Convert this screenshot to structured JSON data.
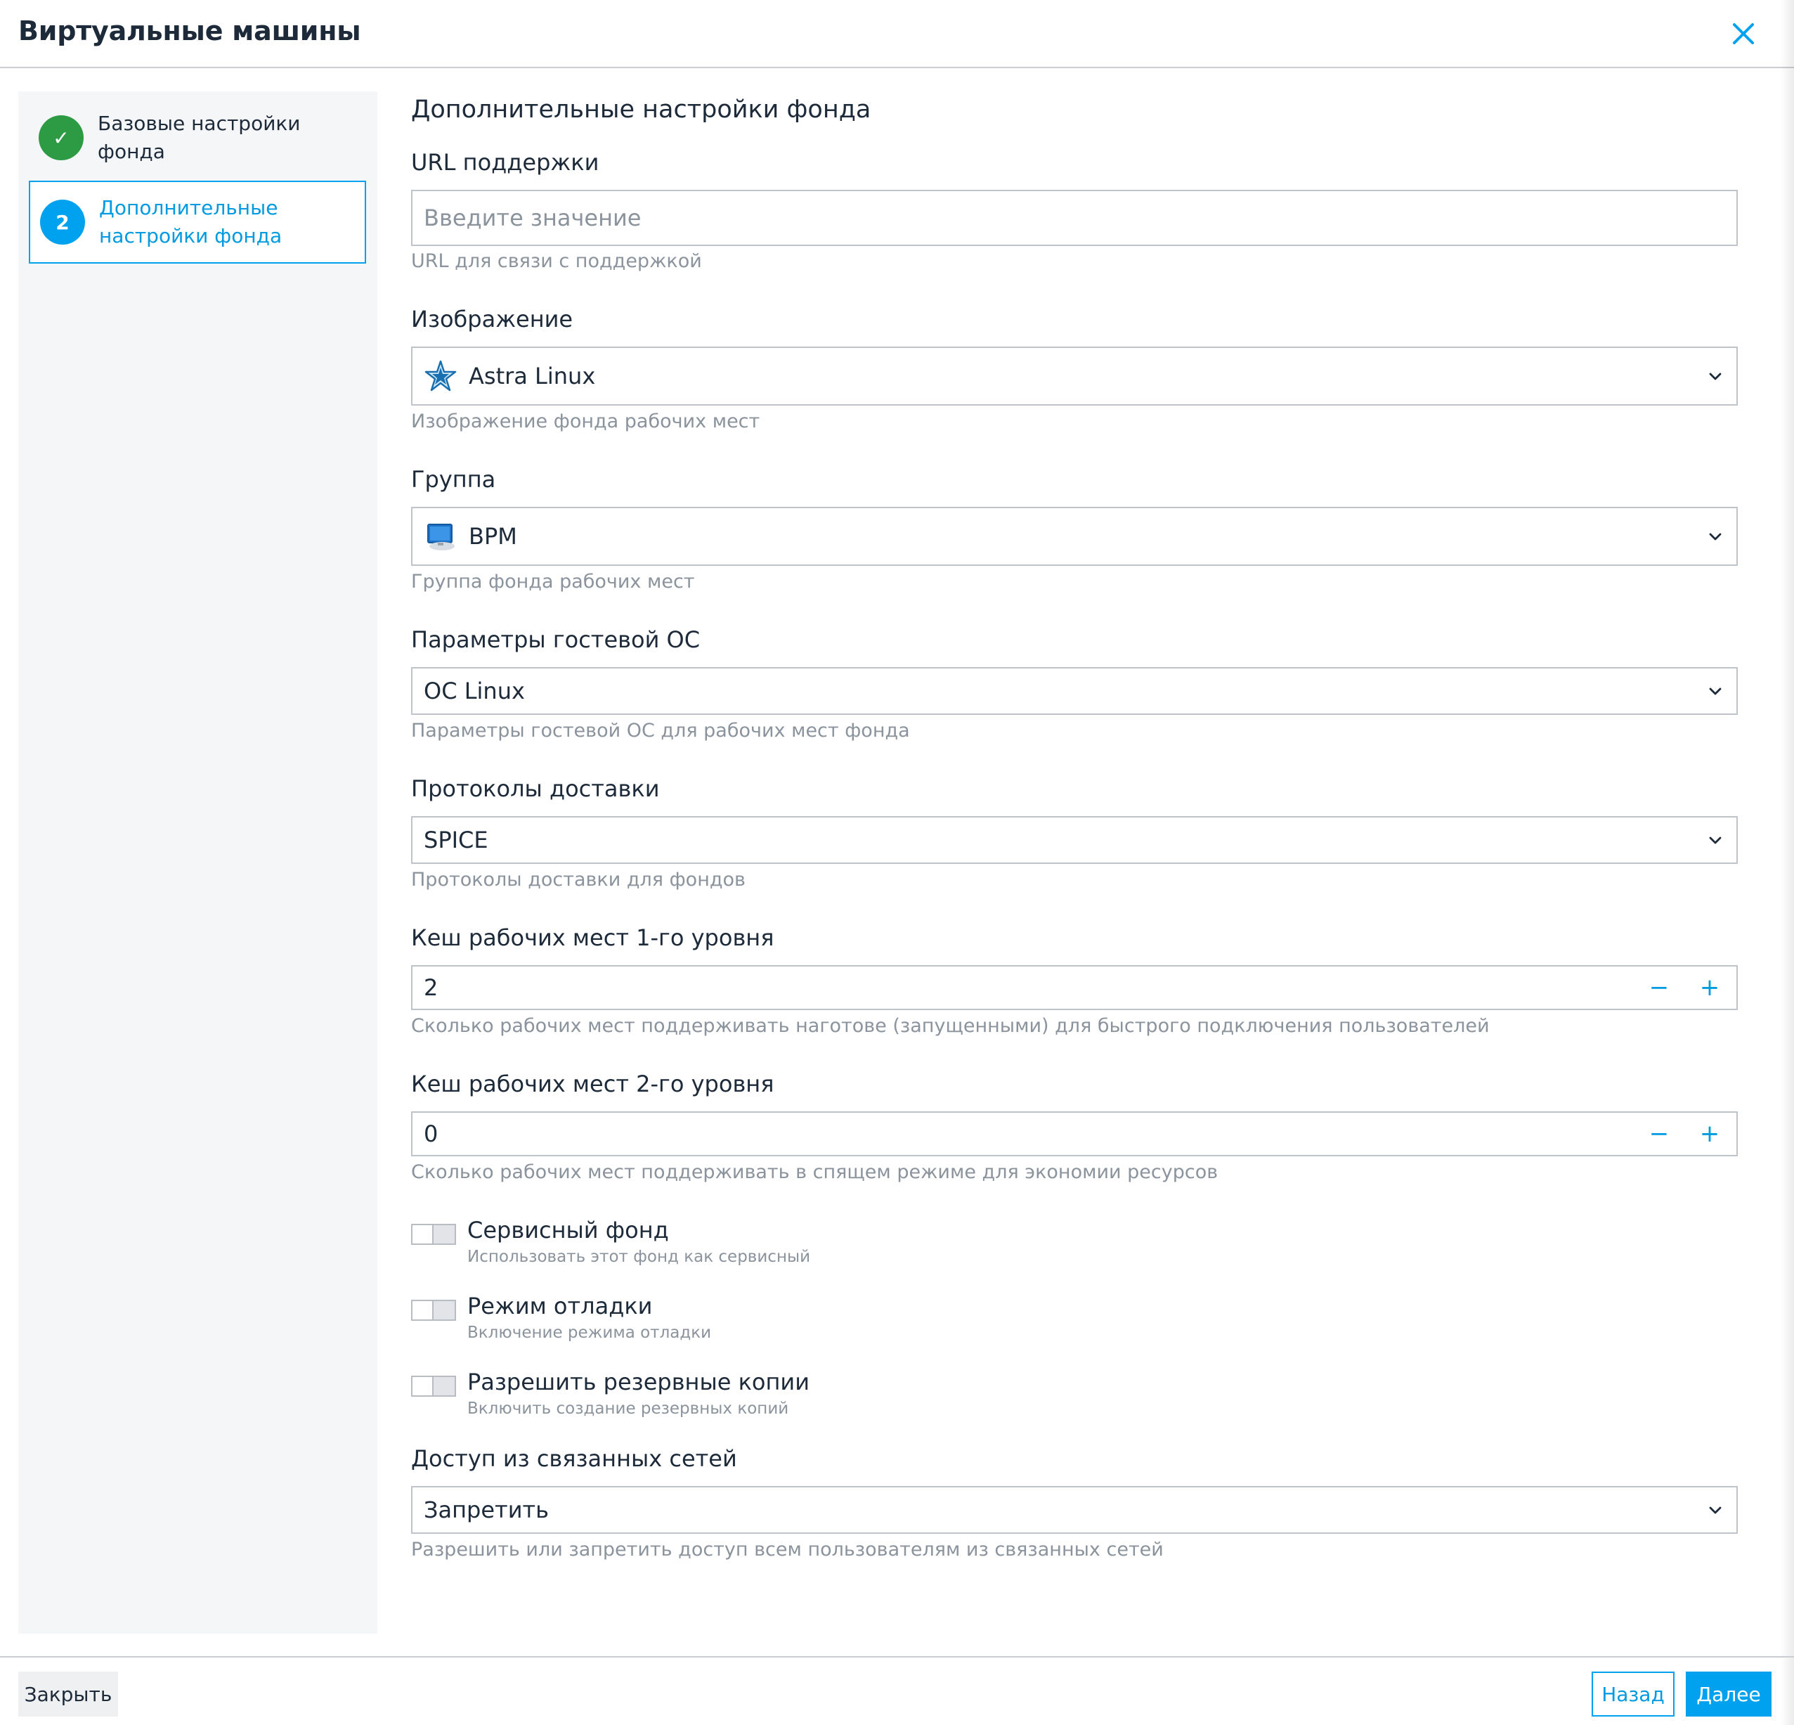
{
  "header": {
    "title": "Виртуальные машины"
  },
  "sidebar": {
    "steps": [
      {
        "number": "✓",
        "label": "Базовые настройки фонда",
        "state": "done"
      },
      {
        "number": "2",
        "label": "Дополнительные настройки фонда",
        "state": "active"
      }
    ]
  },
  "form": {
    "section_title": "Дополнительные настройки фонда",
    "support_url": {
      "label": "URL поддержки",
      "value": "",
      "placeholder": "Введите значение",
      "help": "URL для связи с поддержкой"
    },
    "image": {
      "label": "Изображение",
      "value": "Astra Linux",
      "icon": "astra-star-icon",
      "help": "Изображение фонда рабочих мест"
    },
    "group": {
      "label": "Группа",
      "value": "ВРМ",
      "icon": "monitor-icon",
      "help": "Группа фонда рабочих мест"
    },
    "guest_os": {
      "label": "Параметры гостевой ОС",
      "value": "ОС Linux",
      "help": "Параметры гостевой ОС для рабочих мест фонда"
    },
    "protocols": {
      "label": "Протоколы доставки",
      "value": "SPICE",
      "help": "Протоколы доставки для фондов"
    },
    "cache_l1": {
      "label": "Кеш рабочих мест 1-го уровня",
      "value": "2",
      "help": "Сколько рабочих мест поддерживать наготове (запущенными) для быстрого подключения пользователей"
    },
    "cache_l2": {
      "label": "Кеш рабочих мест 2-го уровня",
      "value": "0",
      "help": "Сколько рабочих мест поддерживать в спящем режиме для экономии ресурсов"
    },
    "service_pool": {
      "title": "Сервисный фонд",
      "subtitle": "Использовать этот фонд как сервисный",
      "checked": false
    },
    "debug_mode": {
      "title": "Режим отладки",
      "subtitle": "Включение режима отладки",
      "checked": false
    },
    "backups": {
      "title": "Разрешить резервные копии",
      "subtitle": "Включить создание резервных копий",
      "checked": false
    },
    "linked_networks": {
      "label": "Доступ из связанных сетей",
      "value": "Запретить",
      "help": "Разрешить или запретить доступ всем пользователям из связанных сетей"
    },
    "stepper": {
      "minus": "−",
      "plus": "+"
    }
  },
  "footer": {
    "close_label": "Закрыть",
    "back_label": "Назад",
    "next_label": "Далее"
  },
  "colors": {
    "accent": "#00a2ef",
    "success": "#2d9b44",
    "text": "#1d2a3a",
    "muted": "#8b939c"
  }
}
